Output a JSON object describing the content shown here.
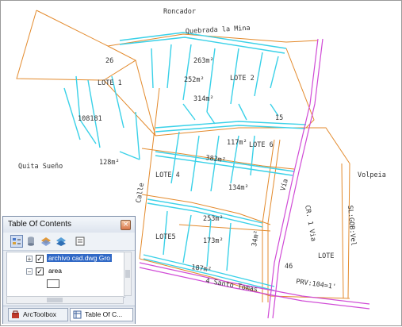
{
  "map": {
    "labels": {
      "roncador": "Roncador",
      "quebrada": "Quebrada la Mina",
      "quita_sueno": "Quita Sueño",
      "volpeia": "Volpeia",
      "lote1": "LOTE 1",
      "lote2": "LOTE 2",
      "lote4": "LOTE 4",
      "lote5": "LOTE5",
      "lote6": "LOTE 6",
      "lote_right": "LOTE",
      "n26": "26",
      "n263": "263m²",
      "n252": "252m²",
      "n314": "314m²",
      "n15": "15",
      "n108": "108181",
      "n128": "128m²",
      "n117": "117m²",
      "n382": "382m²",
      "n134": "134m²",
      "n253": "253m²",
      "n173": "173m²",
      "n187": "187m²",
      "n46": "46",
      "n34": "34m²",
      "prv": "PRV:104=1'",
      "carrera": "4 Santo Tomas",
      "via1": "Calle",
      "via2": "Vía",
      "via3": "CR. 1 Via",
      "via4": "SL:GOB:Vel"
    }
  },
  "toc": {
    "title": "Table Of Contents",
    "close": "×",
    "layers": [
      {
        "label": "archivo cad.dwg Gro",
        "checked": "✓",
        "expander": "+",
        "selected": true
      },
      {
        "label": "area",
        "checked": "✓",
        "expander": "−",
        "selected": false
      }
    ],
    "tabs": [
      {
        "label": "ArcToolbox",
        "icon": "toolbox-icon"
      },
      {
        "label": "Table Of C...",
        "icon": "table-icon"
      }
    ],
    "toolbar_icons": [
      "list-by-drawing-order-icon",
      "list-by-source-icon",
      "list-by-visibility-icon",
      "list-by-selection-icon",
      "options-icon"
    ]
  }
}
